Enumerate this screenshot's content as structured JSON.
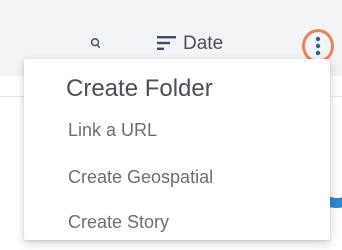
{
  "toolbar": {
    "sort_label": "Date",
    "search_icon": "search-icon",
    "sort_icon": "sort-icon",
    "more_icon": "more-vertical-icon"
  },
  "menu": {
    "items": [
      {
        "label": "Create Folder"
      },
      {
        "label": "Link a URL"
      },
      {
        "label": "Create Geospatial"
      },
      {
        "label": "Create Story"
      }
    ]
  },
  "colors": {
    "highlight_ring": "#ef7f55",
    "accent_blue": "#2f86d1",
    "accent_orange": "#f0a040",
    "text_primary": "#4c4f58",
    "text_secondary": "#6b6e75"
  }
}
